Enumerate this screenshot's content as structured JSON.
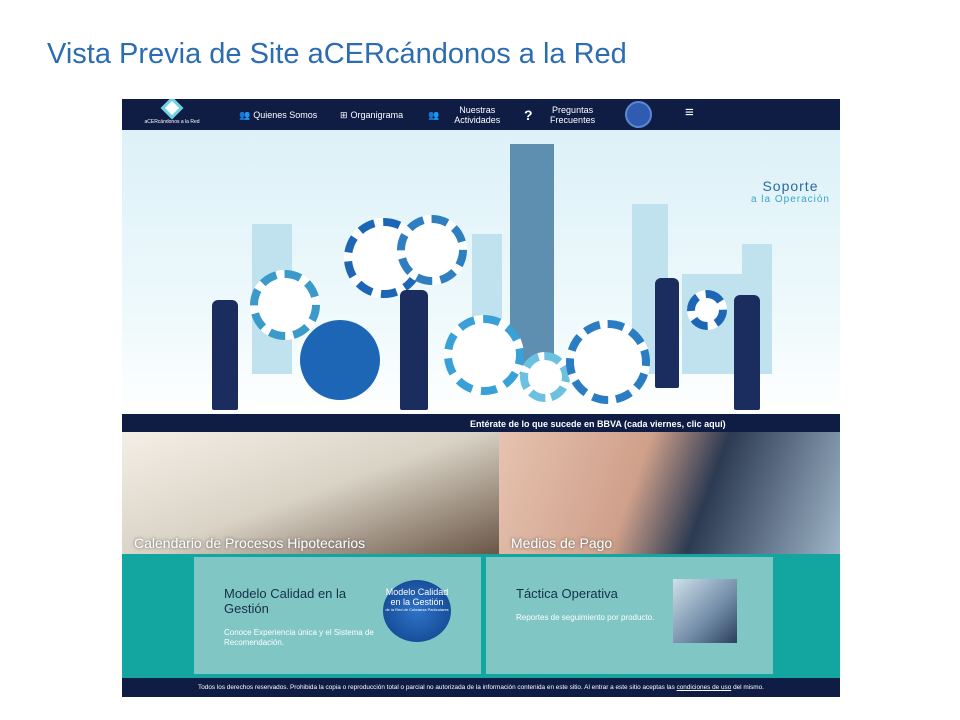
{
  "slide_title": "Vista Previa de Site aCERcándonos a la Red",
  "nav": {
    "logo_text": "aCERcándonos a la Red",
    "items": [
      {
        "label": "Quienes Somos"
      },
      {
        "label": "Organigrama"
      },
      {
        "label": "Nuestras Actividades"
      },
      {
        "label": "Preguntas Frecuentes"
      }
    ]
  },
  "hero": {
    "support_title": "Soporte",
    "support_sub": "a la Operación"
  },
  "strip": "Entérate de lo que sucede en BBVA (cada viernes, clic aquí)",
  "tiles": [
    "Calendario de Procesos Hipotecarios",
    "Medios de Pago"
  ],
  "cards": [
    {
      "title": "Modelo Calidad en la Gestión",
      "text": "Conoce Experiencia única y el Sistema de Recomendación.",
      "badge_title": "Modelo Calidad en la Gestión",
      "badge_sub": "de la Red de Cobranza Particulares"
    },
    {
      "title": "Táctica Operativa",
      "text": "Reportes de seguimiento por producto."
    }
  ],
  "footer": {
    "text": "Todos los derechos reservados. Prohibida la copia o reproducción total o parcial no autorizada de la información contenida en este sitio. Al entrar a este sitio aceptas las",
    "link": "condiciones de uso",
    "tail": "del mismo."
  }
}
